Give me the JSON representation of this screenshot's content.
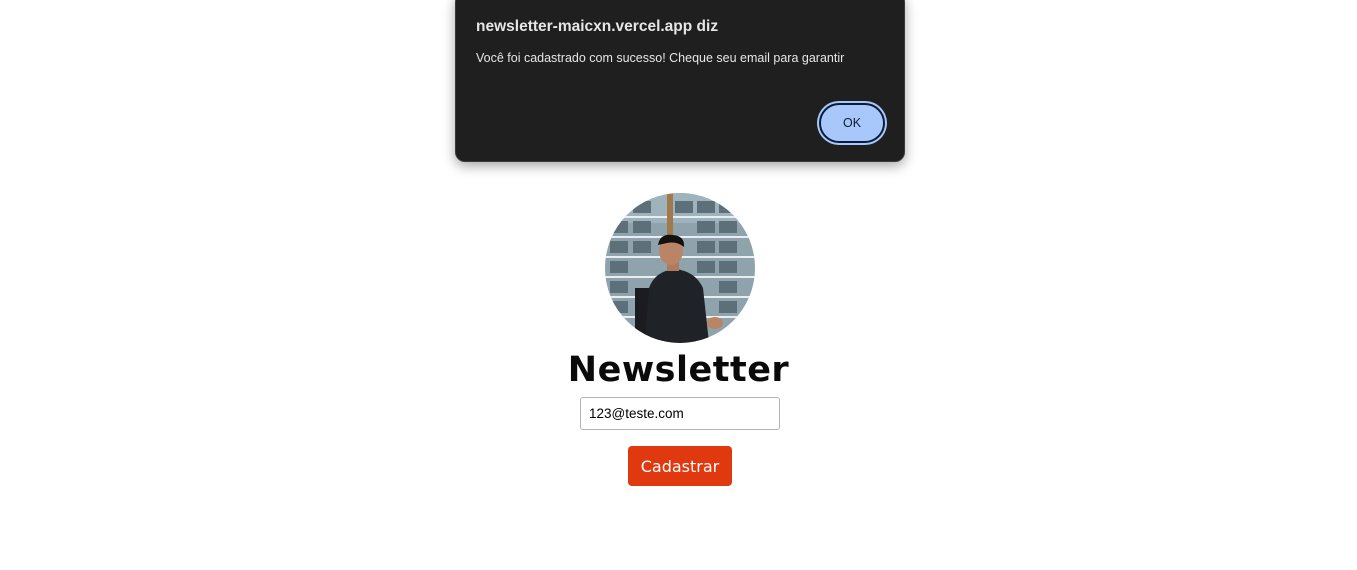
{
  "alert": {
    "title": "newsletter-maicxn.vercel.app diz",
    "message": "Você foi cadastrado com sucesso! Cheque seu email para garantir",
    "ok_label": "OK"
  },
  "main": {
    "title": "Newsletter",
    "email_value": "123@teste.com",
    "submit_label": "Cadastrar"
  },
  "colors": {
    "dialog_bg": "#1f1f1f",
    "ok_button_bg": "#a8c7fa",
    "submit_button_bg": "#e0380f"
  }
}
